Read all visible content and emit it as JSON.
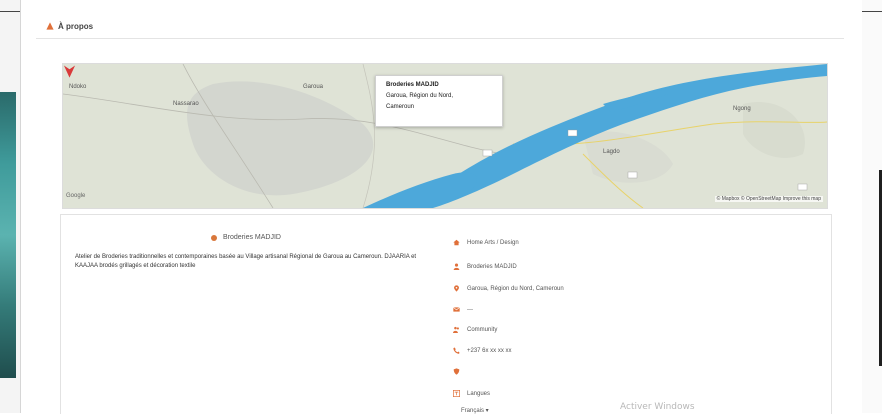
{
  "section": {
    "title": "À propos"
  },
  "map": {
    "labels": [
      "Ndoko",
      "Garoua",
      "Nassarao",
      "Ngong",
      "Lagdo"
    ],
    "popup": {
      "name": "Broderies MADJID",
      "address": "Garoua, Région du Nord,",
      "country": "Cameroun"
    },
    "google": "Google",
    "attribution": "© Mapbox © OpenStreetMap Improve this map"
  },
  "business": {
    "name": "Broderies MADJID",
    "description": "Atelier de Broderies traditionnelles et contemporaines basée au Village artisanal Régional de Garoua au Cameroun. DJAARIA et KAAJAA brodés grillagés et décoration textile",
    "details": [
      {
        "icon": "home-icon",
        "text": "Home Arts / Design",
        "color": "#e0703a"
      },
      {
        "icon": "user-icon",
        "text": "Broderies MADJID",
        "color": "#e0703a"
      },
      {
        "icon": "location-pin-icon",
        "text": "Garoua, Région du Nord, Cameroun",
        "color": "#e0703a"
      },
      {
        "icon": "mail-icon",
        "text": "---",
        "color": "#e0703a"
      },
      {
        "icon": "users-icon",
        "text": "Community",
        "color": "#e0703a"
      },
      {
        "icon": "phone-icon",
        "text": "+237 6x xx xx xx",
        "color": "#e0703a"
      },
      {
        "icon": "shield-icon",
        "text": "",
        "color": "#e0703a"
      },
      {
        "icon": "translate-icon",
        "text": "Langues",
        "color": "#e0703a"
      }
    ],
    "language_select": "Français ▾"
  },
  "watermark": "Activer Windows",
  "colors": {
    "accent": "#e0703a",
    "river": "#4da8da",
    "map_base": "#dfe4d8"
  }
}
